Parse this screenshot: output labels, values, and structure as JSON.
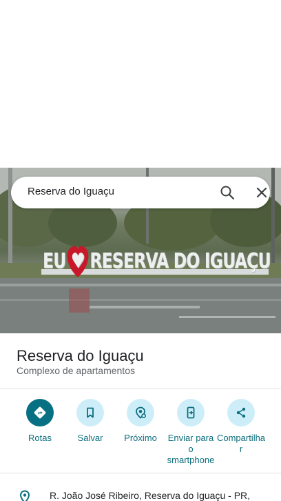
{
  "search": {
    "query": "Reserva do Iguaçu"
  },
  "photo": {
    "sign_text": "EU ♥ RESERVA DO IGUAÇU"
  },
  "place": {
    "title": "Reserva do Iguaçu",
    "subtitle": "Complexo de apartamentos"
  },
  "actions": [
    {
      "label": "Rotas",
      "icon": "directions-icon"
    },
    {
      "label": "Salvar",
      "icon": "bookmark-icon"
    },
    {
      "label": "Próximo",
      "icon": "nearby-icon"
    },
    {
      "label": "Enviar para o smartphone",
      "icon": "send-to-phone-icon"
    },
    {
      "label": "Compartilhar",
      "icon": "share-icon"
    }
  ],
  "address": {
    "text": "R. João José Ribeiro, Reserva do Iguaçu - PR,"
  },
  "colors": {
    "accent": "#077083",
    "action_bg": "#cdeef9",
    "action_label": "#0b6e7d"
  }
}
